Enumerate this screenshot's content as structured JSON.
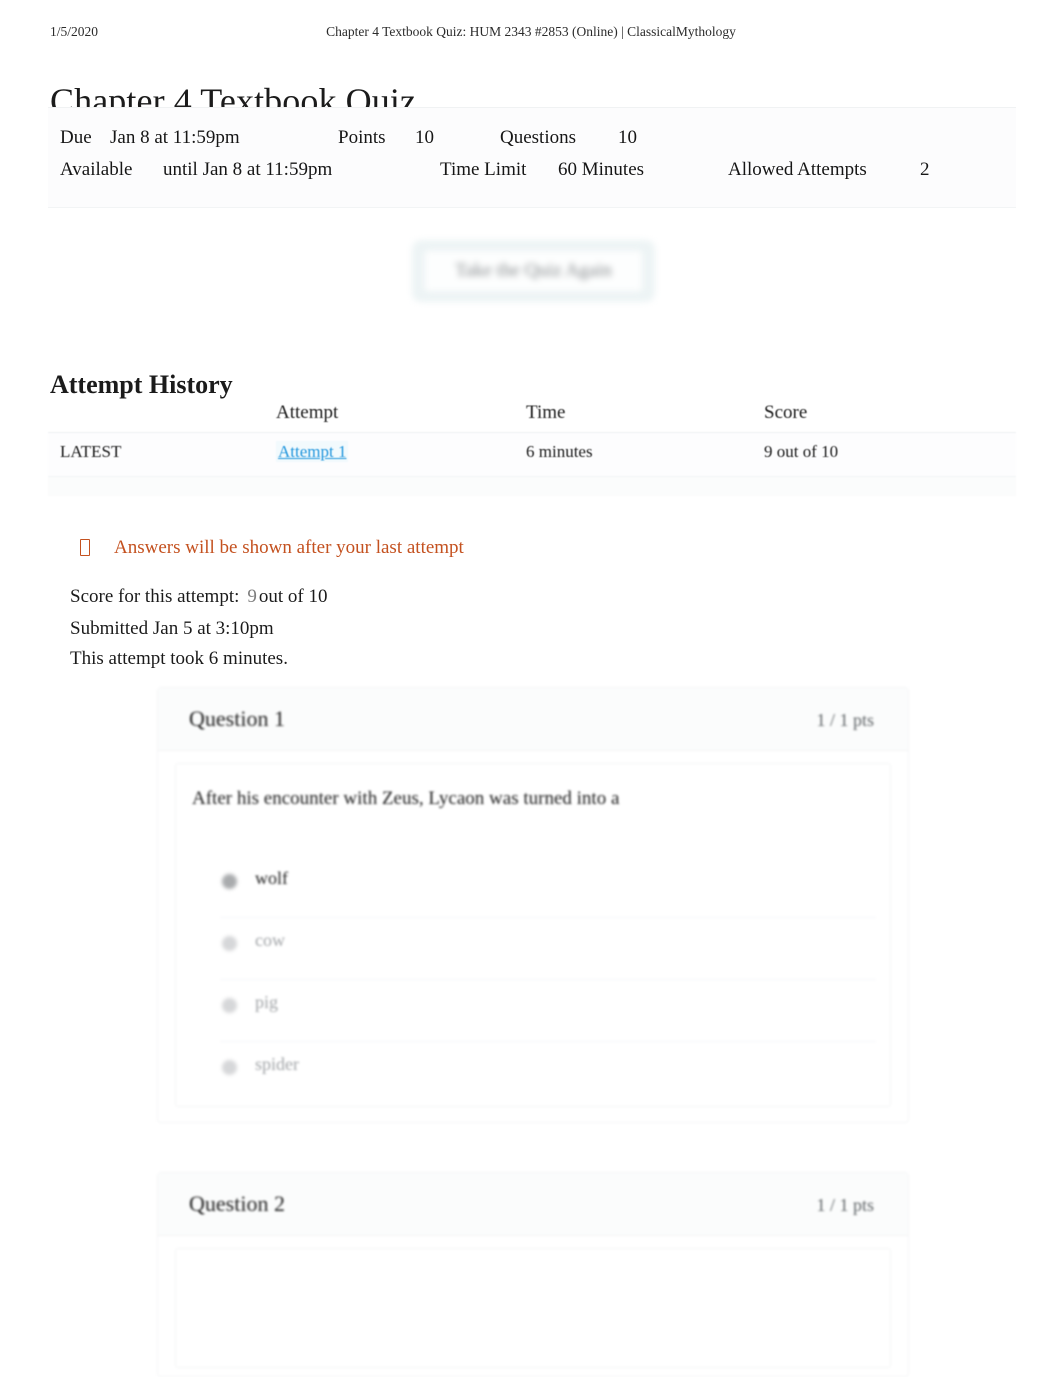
{
  "print_header": {
    "date": "1/5/2020",
    "title": "Chapter 4 Textbook Quiz: HUM 2343 #2853 (Online) | ClassicalMythology"
  },
  "page_title": "Chapter 4 Textbook Quiz",
  "quiz_details": {
    "due_label": "Due",
    "due_value": "Jan 8 at 11:59pm",
    "points_label": "Points",
    "points_value": "10",
    "questions_label": "Questions",
    "questions_value": "10",
    "available_label": "Available",
    "available_value": "until Jan 8 at 11:59pm",
    "time_limit_label": "Time Limit",
    "time_limit_value": "60 Minutes",
    "allowed_attempts_label": "Allowed Attempts",
    "allowed_attempts_value": "2"
  },
  "retake_button": {
    "label": "Take the Quiz Again"
  },
  "attempt_history": {
    "heading": "Attempt History",
    "columns": [
      "",
      "Attempt",
      "Time",
      "Score"
    ],
    "rows": [
      {
        "kept": "LATEST",
        "attempt": "Attempt 1",
        "time": "6 minutes",
        "score": "9 out of 10"
      }
    ]
  },
  "answers_notice": {
    "icon": "info-icon",
    "text": "Answers will be shown after your last attempt",
    "color": "#c4511f"
  },
  "attempt_summary": {
    "score_label": "Score for this attempt:",
    "score_number": "9",
    "score_suffix": "out of 10",
    "submitted": "Submitted Jan 5 at 3:10pm",
    "duration": "This attempt took 6 minutes."
  },
  "questions": [
    {
      "title": "Question 1",
      "points": "1 / 1 pts",
      "text": "After his encounter with Zeus, Lycaon was turned into a",
      "answers": [
        {
          "label": "wolf",
          "selected": true
        },
        {
          "label": "cow",
          "selected": false
        },
        {
          "label": "pig",
          "selected": false
        },
        {
          "label": "spider",
          "selected": false
        }
      ]
    },
    {
      "title": "Question 2",
      "points": "1 / 1 pts",
      "text": "",
      "answers": []
    }
  ],
  "colors": {
    "link": "#2196dd",
    "notice": "#c4511f",
    "body_text": "#1b1b1b",
    "muted_text": "#a2a5a8"
  }
}
